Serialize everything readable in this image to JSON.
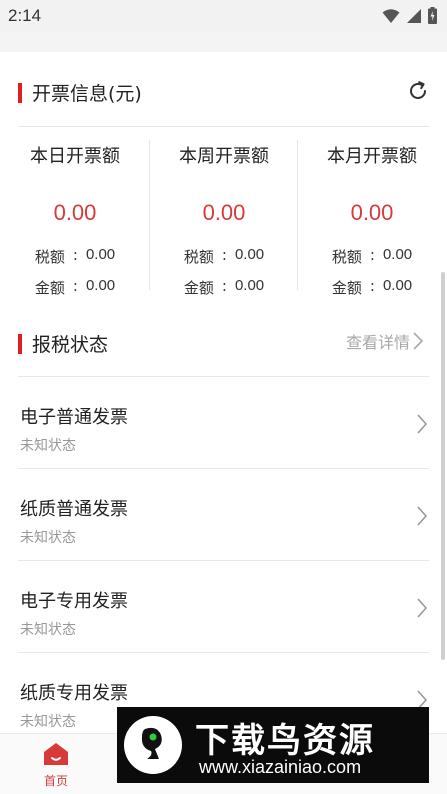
{
  "status_bar": {
    "time": "2:14"
  },
  "invoice_info": {
    "title": "开票信息(元)",
    "columns": [
      {
        "heading": "本日开票额",
        "amount": "0.00",
        "tax_label": "税额",
        "tax_value": "0.00",
        "total_label": "金额",
        "total_value": "0.00"
      },
      {
        "heading": "本周开票额",
        "amount": "0.00",
        "tax_label": "税额",
        "tax_value": "0.00",
        "total_label": "金额",
        "total_value": "0.00"
      },
      {
        "heading": "本月开票额",
        "amount": "0.00",
        "tax_label": "税额",
        "tax_value": "0.00",
        "total_label": "金额",
        "total_value": "0.00"
      }
    ],
    "separator": ":"
  },
  "tax_status": {
    "title": "报税状态",
    "detail_link": "查看详情",
    "items": [
      {
        "title": "电子普通发票",
        "status": "未知状态"
      },
      {
        "title": "纸质普通发票",
        "status": "未知状态"
      },
      {
        "title": "电子专用发票",
        "status": "未知状态"
      },
      {
        "title": "纸质专用发票",
        "status": "未知状态"
      }
    ]
  },
  "bottom_nav": {
    "home_label": "首页"
  },
  "watermark": {
    "title": "下载鸟资源",
    "url": "www.xiazainiao.com"
  },
  "colors": {
    "accent": "#e02020",
    "amount": "#d83a3a",
    "muted": "#999999"
  }
}
